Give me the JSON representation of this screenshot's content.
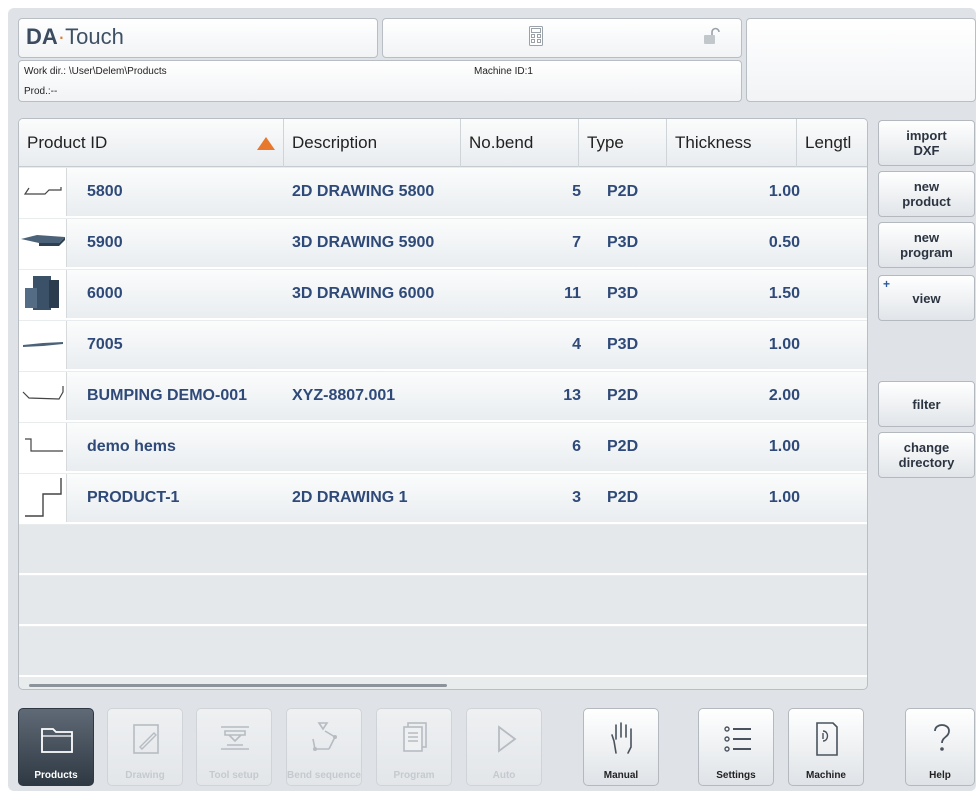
{
  "header": {
    "app_name_bold": "DA",
    "app_name_sep": "·",
    "app_name_rest": "Touch",
    "work_dir": "Work dir.: \\User\\Delem\\Products",
    "prod": "Prod.:--",
    "machine_id": "Machine ID:1",
    "icons": {
      "calculator": "calculator-icon",
      "lock": "unlocked-padlock-icon"
    }
  },
  "table": {
    "columns": [
      "Product ID",
      "Description",
      "No.bend",
      "Type",
      "Thickness",
      "Lengtl"
    ],
    "sort": {
      "column": "Product ID",
      "direction": "ascending",
      "color": "#e8782b"
    },
    "rows": [
      {
        "thumb": "2d-outline-thumbnail",
        "id": "5800",
        "description": "2D DRAWING 5800",
        "bends": "5",
        "type": "P2D",
        "thickness": "1.00"
      },
      {
        "thumb": "3d-part-thumbnail",
        "id": "5900",
        "description": "3D DRAWING 5900",
        "bends": "7",
        "type": "P3D",
        "thickness": "0.50"
      },
      {
        "thumb": "3d-part-thumbnail",
        "id": "6000",
        "description": "3D DRAWING 6000",
        "bends": "11",
        "type": "P3D",
        "thickness": "1.50"
      },
      {
        "thumb": "3d-part-thumbnail",
        "id": "7005",
        "description": "",
        "bends": "4",
        "type": "P3D",
        "thickness": "1.00"
      },
      {
        "thumb": "2d-outline-thumbnail",
        "id": "BUMPING DEMO-001",
        "description": "XYZ-8807.001",
        "bends": "13",
        "type": "P2D",
        "thickness": "2.00"
      },
      {
        "thumb": "2d-outline-thumbnail",
        "id": "demo hems",
        "description": "",
        "bends": "6",
        "type": "P2D",
        "thickness": "1.00"
      },
      {
        "thumb": "2d-outline-thumbnail",
        "id": "PRODUCT-1",
        "description": "2D DRAWING 1",
        "bends": "3",
        "type": "P2D",
        "thickness": "1.00"
      }
    ]
  },
  "side_buttons": {
    "import_dxf": [
      "import",
      "DXF"
    ],
    "new_product": [
      "new",
      "product"
    ],
    "new_program": [
      "new",
      "program"
    ],
    "view": {
      "plus": "+",
      "label": "view"
    },
    "filter": "filter",
    "change_directory": [
      "change",
      "directory"
    ]
  },
  "nav": [
    {
      "key": "products",
      "label": "Products",
      "icon": "folder-icon",
      "state": "active"
    },
    {
      "key": "drawing",
      "label": "Drawing",
      "icon": "drawing-icon",
      "state": "disabled"
    },
    {
      "key": "tool_setup",
      "label": "Tool setup",
      "icon": "tool-setup-icon",
      "state": "disabled"
    },
    {
      "key": "bend_sequence",
      "label": "Bend sequence",
      "icon": "bend-sequence-icon",
      "state": "disabled"
    },
    {
      "key": "program",
      "label": "Program",
      "icon": "program-icon",
      "state": "disabled"
    },
    {
      "key": "auto",
      "label": "Auto",
      "icon": "play-icon",
      "state": "disabled"
    },
    {
      "key": "manual",
      "label": "Manual",
      "icon": "hand-icon",
      "state": "normal"
    },
    {
      "key": "settings",
      "label": "Settings",
      "icon": "settings-list-icon",
      "state": "normal"
    },
    {
      "key": "machine",
      "label": "Machine",
      "icon": "machine-icon",
      "state": "normal"
    },
    {
      "key": "help",
      "label": "Help",
      "icon": "question-icon",
      "state": "normal"
    }
  ],
  "colors": {
    "accent": "#e8782b",
    "text_blue": "#2f4a78",
    "active_nav": "#2f3944"
  }
}
